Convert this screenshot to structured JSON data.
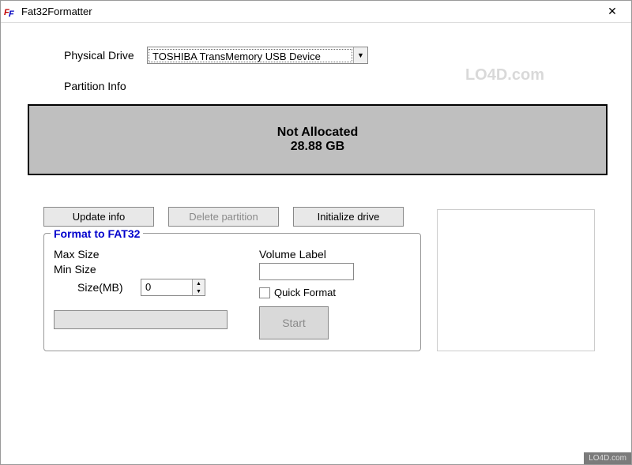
{
  "window": {
    "title": "Fat32Formatter"
  },
  "drive": {
    "label": "Physical Drive",
    "selected": "TOSHIBA TransMemory USB Device"
  },
  "partition": {
    "label": "Partition Info",
    "status": "Not Allocated",
    "size": "28.88 GB"
  },
  "buttons": {
    "update": "Update info",
    "delete": "Delete partition",
    "initialize": "Initialize drive"
  },
  "format": {
    "title": "Format to FAT32",
    "max_size_label": "Max Size",
    "min_size_label": "Min Size",
    "size_label": "Size(MB)",
    "size_value": "0",
    "volume_label": "Volume Label",
    "volume_value": "",
    "quick_format_label": "Quick Format",
    "start_label": "Start"
  },
  "watermark": "LO4D.com"
}
